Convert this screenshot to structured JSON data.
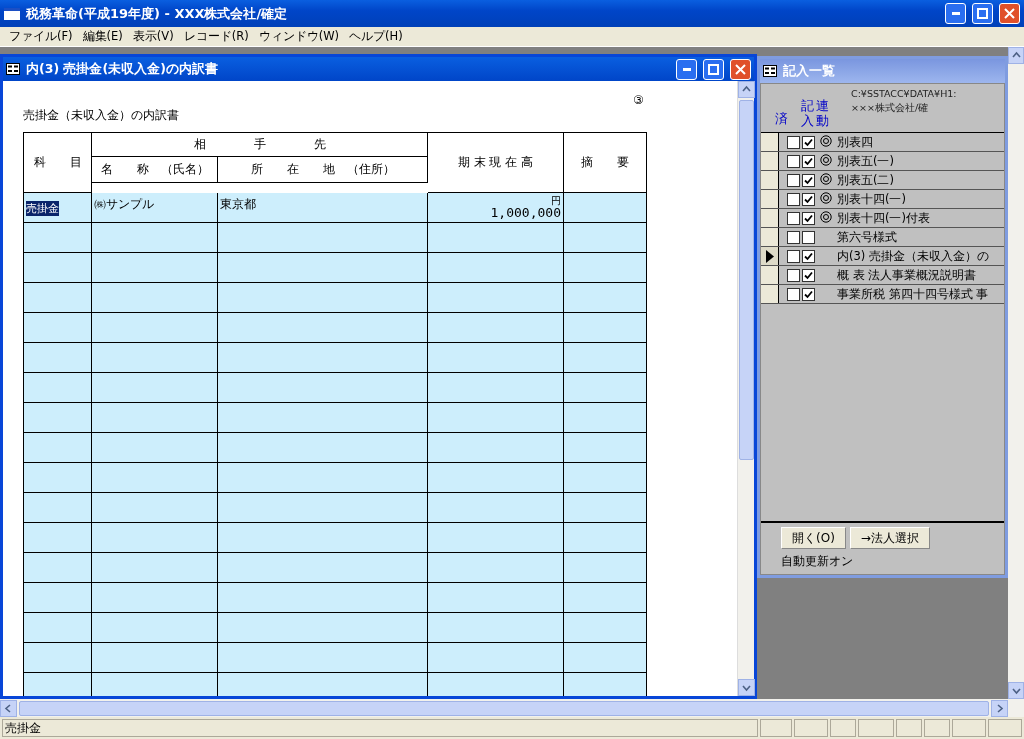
{
  "window": {
    "title": "税務革命(平成19年度) - XXX株式会社/確定"
  },
  "menu": [
    {
      "label": "ファイル(F)"
    },
    {
      "label": "編集(E)"
    },
    {
      "label": "表示(V)"
    },
    {
      "label": "レコード(R)"
    },
    {
      "label": "ウィンドウ(W)"
    },
    {
      "label": "ヘルプ(H)"
    }
  ],
  "document_window": {
    "title": "内(3) 売掛金(未収入金)の内訳書",
    "form_number": "③",
    "form_title": "売掛金（未収入金）の内訳書",
    "headers": {
      "kamoku": "科　　目",
      "partner": "相　　　　手　　　　先",
      "name": "名　　称　（氏名）",
      "address": "所　　在　　地　（住所）",
      "amount": "期 末 現 在 高",
      "note": "摘　　要"
    },
    "rows": [
      {
        "kamoku": "売掛金",
        "kamoku_selected": true,
        "name": "㈱サンプル",
        "address": "東京都",
        "unit": "円",
        "amount": "1,000,000"
      }
    ]
  },
  "list_window": {
    "title": "記入一覧",
    "col_done": "済",
    "col_entered": "記入",
    "col_linked": "連動",
    "path": "C:¥SSTACC¥DATA¥H1:",
    "company": "×××株式会社/確",
    "items": [
      {
        "label": "別表四",
        "done": false,
        "entered": true,
        "linked": true,
        "selected": false
      },
      {
        "label": "別表五(一)",
        "done": false,
        "entered": true,
        "linked": true,
        "selected": false
      },
      {
        "label": "別表五(二)",
        "done": false,
        "entered": true,
        "linked": true,
        "selected": false
      },
      {
        "label": "別表十四(一)",
        "done": false,
        "entered": true,
        "linked": true,
        "selected": false
      },
      {
        "label": "別表十四(一)付表",
        "done": false,
        "entered": true,
        "linked": true,
        "selected": false
      },
      {
        "label": "第六号様式",
        "done": false,
        "entered": false,
        "linked": false,
        "selected": false
      },
      {
        "label": "内(3) 売掛金（未収入金）の",
        "done": false,
        "entered": true,
        "linked": false,
        "selected": true
      },
      {
        "label": "概 表 法人事業概況説明書",
        "done": false,
        "entered": true,
        "linked": false,
        "selected": false
      },
      {
        "label": "事業所税 第四十四号様式 事",
        "done": false,
        "entered": true,
        "linked": false,
        "selected": false
      }
    ],
    "buttons": [
      {
        "label": "開く(O)"
      },
      {
        "label": "→法人選択"
      }
    ],
    "auto_update": "自動更新オン"
  },
  "status_bar": {
    "text": "売掛金"
  }
}
